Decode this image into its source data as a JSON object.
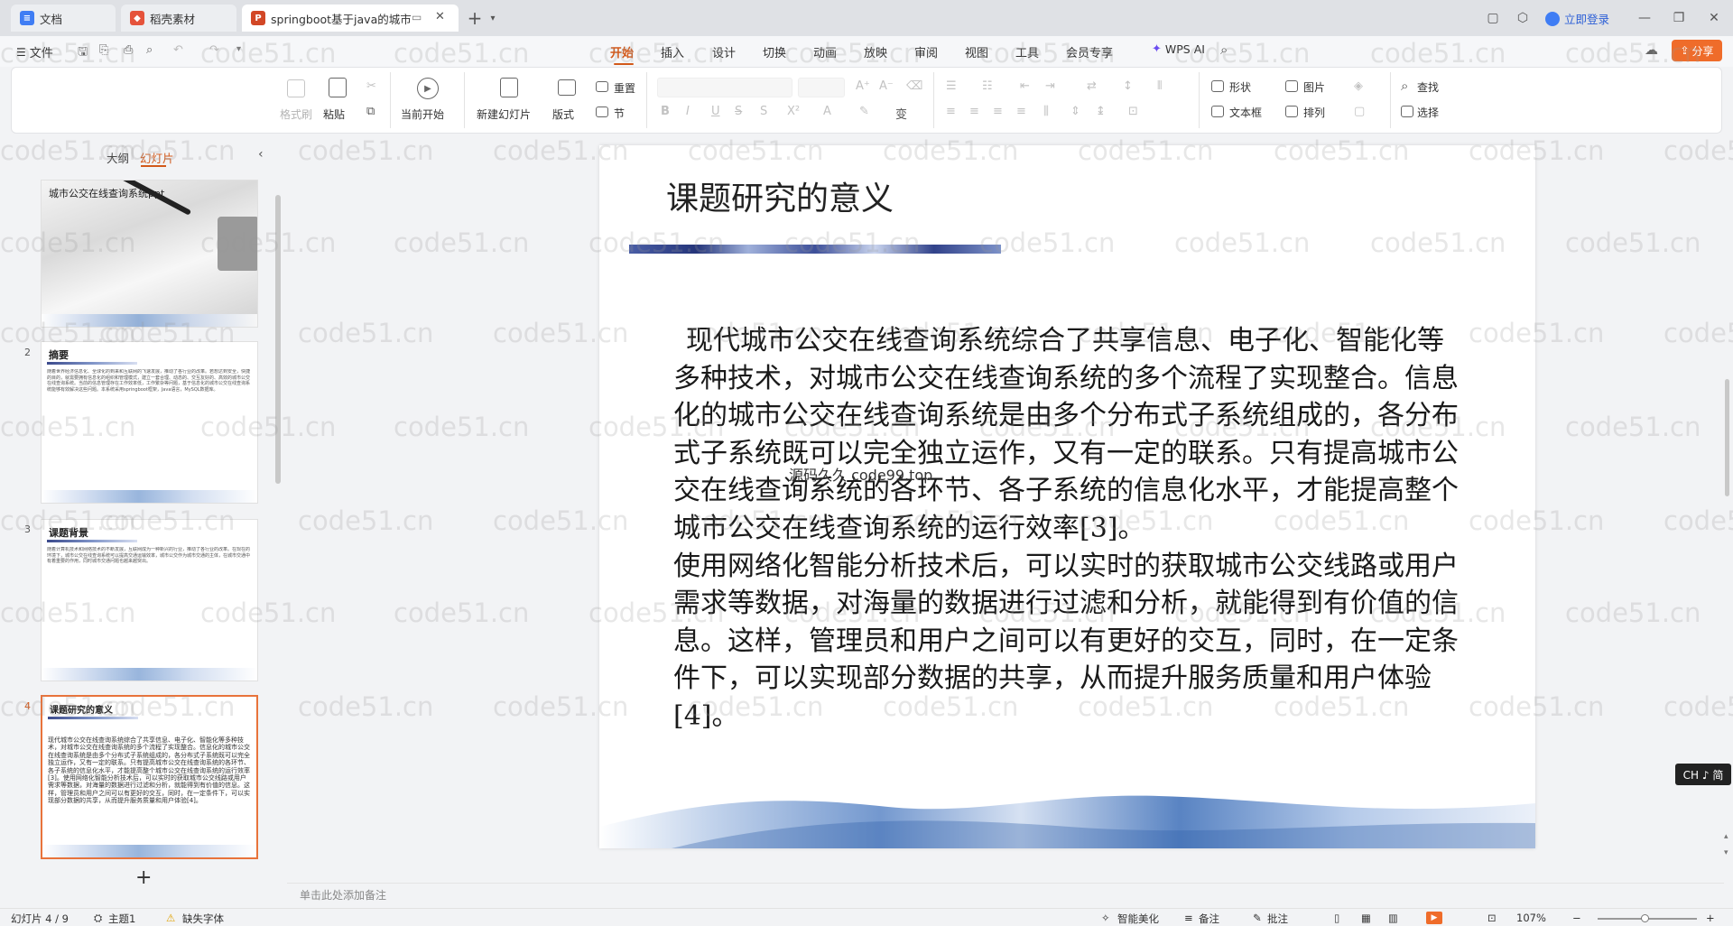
{
  "tabs": [
    {
      "label": "文档",
      "icon": "document-icon",
      "color": "#3f7df4"
    },
    {
      "label": "稻壳素材",
      "icon": "docer-icon",
      "color": "#e5533b"
    },
    {
      "label": "springboot基于java的城市",
      "icon": "ppt-icon",
      "color": "#d24726"
    }
  ],
  "titlebar": {
    "login_label": "立即登录"
  },
  "menu": {
    "file_label": "文件",
    "tabs": [
      "开始",
      "插入",
      "设计",
      "切换",
      "动画",
      "放映",
      "审阅",
      "视图",
      "工具",
      "会员专享"
    ],
    "active_tab": "开始",
    "wps_ai_label": "WPS AI",
    "share_label": "分享"
  },
  "ribbon": {
    "format_painter": "格式刷",
    "paste": "粘贴",
    "start_from_current": "当前开始",
    "new_slide": "新建幻灯片",
    "layout": "版式",
    "reset": "重置",
    "section": "节",
    "shape": "形状",
    "picture": "图片",
    "textbox": "文本框",
    "arrange": "排列",
    "find": "查找",
    "select": "选择"
  },
  "left_panel": {
    "tab_outline": "大纲",
    "tab_slides": "幻灯片",
    "slides": [
      {
        "num": "",
        "title": "城市公交在线查询系统ppt",
        "body": ""
      },
      {
        "num": "2",
        "title": "摘要",
        "body": "随着世界经济信息化、全球化的到来和互联网的飞速发展，推动了各行业的改革。若想达到安全，快捷的目的，就需要拥有信息化的组织和管理模式，建立一套合理、动态的、交互友好的、高效的城市公交在线查询系统。当前的信息管理存在工作效率低，工作繁杂等问题，基于信息化的城市公交在线查询系统能够有效解决这些问题。本系统采用springboot框架，Java语言，MySQL数据库。"
      },
      {
        "num": "3",
        "title": "课题背景",
        "body": "随着计算机技术和网络技术的不断发展，互联网成为一种新兴的行业，推动了各行业的改革。在现在的环境下，城市公交在线查询系统可以提高交通运输效率，城市公交作为城市交通的主体，在城市交通中有着重要的作用，同时城市交通问题也越来越突出。"
      },
      {
        "num": "4",
        "title": "课题研究的意义",
        "body": "现代城市公交在线查询系统综合了共享信息、电子化、智能化等多种技术，对城市公交在线查询系统的多个流程了实现整合。信息化的城市公交在线查询系统是由多个分布式子系统组成的，各分布式子系统既可以完全独立运作，又有一定的联系。只有提高城市公交在线查询系统的各环节、各子系统的信息化水平，才能提高整个城市公交在线查询系统的运行效率[3]。使用网络化智能分析技术后，可以实时的获取城市公交线路或用户需求等数据，对海量的数据进行过滤和分析，就能得到有价值的信息。这样，管理员和用户之间可以有更好的交互，同时，在一定条件下，可以实现部分数据的共享，从而提升服务质量和用户体验[4]。"
      }
    ]
  },
  "slide": {
    "title": "课题研究的意义",
    "paragraph1": "现代城市公交在线查询系统综合了共享信息、电子化、智能化等多种技术，对城市公交在线查询系统的多个流程了实现整合。信息化的城市公交在线查询系统是由多个分布式子系统组成的，各分布式子系统既可以完全独立运作，又有一定的联系。只有提高城市公交在线查询系统的各环节、各子系统的信息化水平，才能提高整个城市公交在线查询系统的运行效率[3]。",
    "paragraph2": "使用网络化智能分析技术后，可以实时的获取城市公交线路或用户需求等数据，对海量的数据进行过滤和分析，就能得到有价值的信息。这样，管理员和用户之间可以有更好的交互，同时，在一定条件下，可以实现部分数据的共享，从而提升服务质量和用户体验[4]。",
    "watermark_inline": "源码久久 code99.top"
  },
  "notes_placeholder": "单击此处添加备注",
  "status": {
    "slide_counter": "幻灯片 4 / 9",
    "theme": "主题1",
    "missing_font": "缺失字体",
    "smart_beautify": "智能美化",
    "notes": "备注",
    "comment": "批注",
    "zoom": "107%",
    "ime": "CH ♪ 简"
  },
  "watermark": "code51.cn",
  "colors": {
    "accent": "#d2591a",
    "selection": "#e8733b"
  }
}
